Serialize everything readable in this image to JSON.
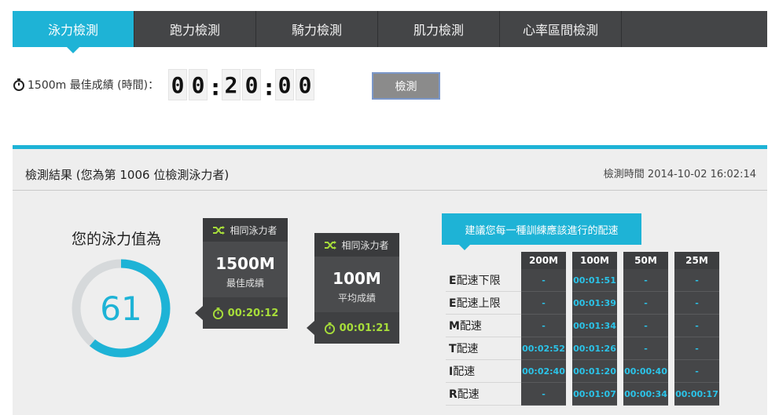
{
  "tabs": [
    {
      "label": "泳力檢測",
      "active": true
    },
    {
      "label": "跑力檢測",
      "active": false
    },
    {
      "label": "騎力檢測",
      "active": false
    },
    {
      "label": "肌力檢測",
      "active": false
    },
    {
      "label": "心率區間檢測",
      "active": false
    }
  ],
  "input": {
    "label": "1500m 最佳成績 (時間)：",
    "hours": [
      "0",
      "0"
    ],
    "minutes": [
      "2",
      "0"
    ],
    "seconds": [
      "0",
      "0"
    ],
    "separator": ":",
    "button_label": "檢測"
  },
  "result": {
    "title": "檢測結果 (您為第 1006 位檢測泳力者)",
    "time": "檢測時間 2014-10-02 16:02:14",
    "score_label": "您的泳力值為",
    "score": "61",
    "score_fraction": 0.61,
    "accent_color": "#1eb3d6",
    "cards": [
      {
        "header": "相同泳力者",
        "value": "1500M",
        "sub": "最佳成績",
        "time": "00:20:12"
      },
      {
        "header": "相同泳力者",
        "value": "100M",
        "sub": "平均成績",
        "time": "00:01:21"
      }
    ],
    "advice": "建議您每一種訓練應該進行的配速",
    "pace": {
      "columns": [
        "200M",
        "100M",
        "50M",
        "25M"
      ],
      "rows": [
        {
          "letter": "E",
          "label": "配速下限",
          "values": [
            "-",
            "00:01:51",
            "-",
            "-"
          ]
        },
        {
          "letter": "E",
          "label": "配速上限",
          "values": [
            "-",
            "00:01:39",
            "-",
            "-"
          ]
        },
        {
          "letter": "M",
          "label": "配速",
          "values": [
            "-",
            "00:01:34",
            "-",
            "-"
          ]
        },
        {
          "letter": "T",
          "label": "配速",
          "values": [
            "00:02:52",
            "00:01:26",
            "-",
            "-"
          ]
        },
        {
          "letter": "I",
          "label": "配速",
          "values": [
            "00:02:40",
            "00:01:20",
            "00:00:40",
            "-"
          ]
        },
        {
          "letter": "R",
          "label": "配速",
          "values": [
            "-",
            "00:01:07",
            "00:00:34",
            "00:00:17"
          ]
        }
      ]
    }
  }
}
